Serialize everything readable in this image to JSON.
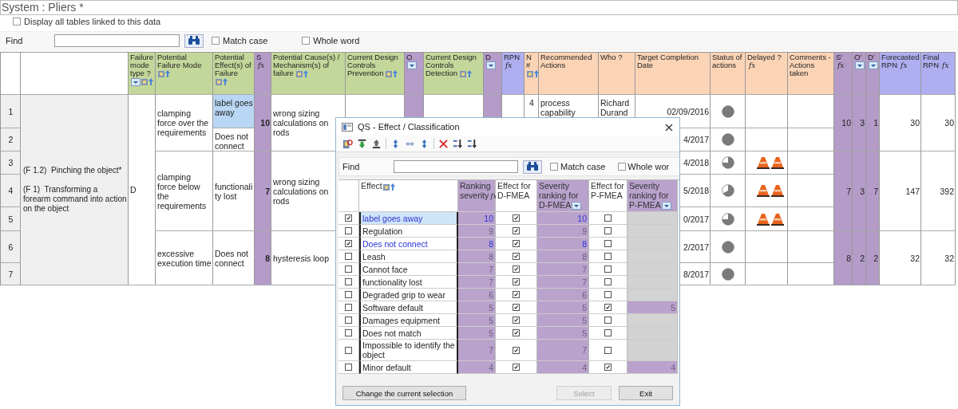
{
  "title": "System : Pliers *",
  "linked_tables": {
    "label": "Display all tables linked to this data",
    "checked": false
  },
  "find": {
    "label": "Find",
    "match_case": {
      "label": "Match case",
      "checked": false
    },
    "whole_word": {
      "label": "Whole word",
      "checked": false
    }
  },
  "table": {
    "columns": [
      {
        "label": "Failure mode type ?",
        "color": "#c4d79b",
        "shaded": false,
        "filter": true,
        "lookup": true
      },
      {
        "label": "Potential Failure Mode",
        "color": "#c4d79b",
        "shaded": false,
        "filter": false,
        "lookup": true
      },
      {
        "label": "Potential Effect(s) of Failure",
        "color": "#c4d79b",
        "shaded": false,
        "filter": false,
        "lookup": true
      },
      {
        "label": "S",
        "color": "#b49bc8",
        "shaded": true,
        "filter": false,
        "lookup": false,
        "fx": "fx"
      },
      {
        "label": "Potential Cause(s) / Mechanism(s) of failure",
        "color": "#c4d79b",
        "shaded": false,
        "filter": false,
        "lookup": true
      },
      {
        "label": "Current Design Controls Prevention",
        "color": "#c4d79b",
        "shaded": false,
        "filter": false,
        "lookup": true
      },
      {
        "label": "O",
        "color": "#b49bc8",
        "shaded": true,
        "filter": true,
        "lookup": false
      },
      {
        "label": "Current Design Controls Detection",
        "color": "#c4d79b",
        "shaded": false,
        "filter": false,
        "lookup": true
      },
      {
        "label": "D",
        "color": "#b49bc8",
        "shaded": true,
        "filter": true,
        "lookup": false
      },
      {
        "label": "RPN",
        "color": "#aeaef0",
        "shaded": false,
        "filter": false,
        "lookup": false,
        "fx": "fx"
      },
      {
        "label": "N#",
        "color": "#fbd4b6",
        "shaded": false,
        "filter": false,
        "lookup": true
      },
      {
        "label": "Recommended Actions",
        "color": "#fbd4b6",
        "shaded": false,
        "filter": false,
        "lookup": false
      },
      {
        "label": "Who ?",
        "color": "#fbd4b6",
        "shaded": false,
        "filter": false,
        "lookup": false
      },
      {
        "label": "Target Completion Date",
        "color": "#fbd4b6",
        "shaded": false,
        "filter": false,
        "lookup": false
      },
      {
        "label": "Status of actions",
        "color": "#fbd4b6",
        "shaded": false,
        "filter": false,
        "lookup": false
      },
      {
        "label": "Delayed ?",
        "color": "#fbd4b6",
        "shaded": false,
        "filter": false,
        "lookup": false,
        "fx": "fx"
      },
      {
        "label": "Comments - Actions taken",
        "color": "#fbd4b6",
        "shaded": false,
        "filter": false,
        "lookup": false
      },
      {
        "label": "S'",
        "color": "#b49bc8",
        "shaded": true,
        "filter": false,
        "lookup": false,
        "fx": "fx"
      },
      {
        "label": "O'",
        "color": "#b49bc8",
        "shaded": true,
        "filter": true,
        "lookup": false
      },
      {
        "label": "D'",
        "color": "#b49bc8",
        "shaded": true,
        "filter": true,
        "lookup": false
      },
      {
        "label": "Forecasted RPN",
        "color": "#aeaef0",
        "shaded": false,
        "filter": false,
        "lookup": false,
        "fx": "fx"
      },
      {
        "label": "Final RPN",
        "color": "#aeaef0",
        "shaded": false,
        "filter": false,
        "lookup": false,
        "fx": "fx"
      }
    ],
    "functions": [
      "(F 1.2)  Pinching the object*",
      "(F 1)  Transforming a forearm command into action on the object"
    ],
    "failure_type": "D",
    "groups": [
      {
        "mode": "clamping force over the requirements",
        "effects": [
          {
            "text": "label goes away",
            "selected": true
          },
          {
            "text": "Does not connect",
            "selected": false
          }
        ],
        "severity": "10",
        "cause": "wrong sizing calculations on rods",
        "s2": "10",
        "o2": "3",
        "d2": "1",
        "forecast": "30",
        "final": "30",
        "rows": [
          {
            "number": "1",
            "n": "4",
            "action": "process capability",
            "who": "Richard Durand",
            "date": "02/09/2016",
            "kind": "full",
            "delayed": false
          },
          {
            "number": "2",
            "date": "4/2017",
            "kind": "full",
            "delayed": false
          }
        ]
      },
      {
        "mode": "clamping force below the requirements",
        "effects": [
          {
            "text": "functionality lost",
            "selected": false
          }
        ],
        "severity": "7",
        "cause": "wrong sizing calculations on rods",
        "s2": "7",
        "o2": "3",
        "d2": "7",
        "forecast": "147",
        "final": "392",
        "rows": [
          {
            "number": "3",
            "date": "4/2018",
            "kind": "three_quarters",
            "delayed": true
          },
          {
            "number": "4",
            "date": "5/2018",
            "kind": "two_thirds",
            "delayed": true
          },
          {
            "number": "5",
            "date": "0/2017",
            "kind": "three_quarters",
            "delayed": true
          }
        ]
      },
      {
        "mode": "excessive execution time",
        "effects": [
          {
            "text": "Does not connect",
            "selected": false
          }
        ],
        "severity": "8",
        "cause": "hysteresis loop",
        "s2": "8",
        "o2": "2",
        "d2": "2",
        "forecast": "32",
        "final": "32",
        "rows": [
          {
            "number": "6",
            "date": "2/2017",
            "kind": "full",
            "delayed": false
          },
          {
            "number": "7",
            "date": "8/2017",
            "kind": "full",
            "delayed": false
          }
        ]
      }
    ]
  },
  "dialog": {
    "title": "QS - Effect / Classification",
    "close": "×",
    "find": {
      "label": "Find",
      "match_case": {
        "label": "Match case",
        "checked": false
      },
      "whole_word": {
        "label": "Whole wor",
        "checked": false
      }
    },
    "columns": [
      {
        "label": "Effect",
        "shaded": false,
        "lookup": true,
        "filter": false
      },
      {
        "label": "Ranking severity",
        "shaded": true,
        "lookup": false,
        "filter": false,
        "fx": "fx"
      },
      {
        "label": "Effect for D-FMEA",
        "shaded": false,
        "lookup": false,
        "filter": false
      },
      {
        "label": "Severity ranking for D-FMEA",
        "shaded": true,
        "lookup": false,
        "filter": true
      },
      {
        "label": "Effect for P-FMEA",
        "shaded": false,
        "lookup": false,
        "filter": false
      },
      {
        "label": "Severity ranking for P-FMEA",
        "shaded": true,
        "lookup": false,
        "filter": true
      }
    ],
    "effects": [
      {
        "name": "label goes away",
        "selected": true,
        "current": true,
        "ranking": "10",
        "d_fmea": true,
        "d_rank": "10",
        "p_fmea": false
      },
      {
        "name": "Regulation",
        "selected": false,
        "current": false,
        "ranking": "9",
        "d_fmea": true,
        "d_rank": "9",
        "p_fmea": false
      },
      {
        "name": "Does not connect",
        "selected": true,
        "current": false,
        "ranking": "8",
        "d_fmea": true,
        "d_rank": "8",
        "p_fmea": false
      },
      {
        "name": "Leash",
        "selected": false,
        "current": false,
        "ranking": "8",
        "d_fmea": true,
        "d_rank": "8",
        "p_fmea": false
      },
      {
        "name": "Cannot face",
        "selected": false,
        "current": false,
        "ranking": "7",
        "d_fmea": true,
        "d_rank": "7",
        "p_fmea": false
      },
      {
        "name": "functionality lost",
        "selected": false,
        "current": false,
        "ranking": "7",
        "d_fmea": true,
        "d_rank": "7",
        "p_fmea": false
      },
      {
        "name": "Degraded grip to wear",
        "selected": false,
        "current": false,
        "ranking": "6",
        "d_fmea": true,
        "d_rank": "6",
        "p_fmea": false
      },
      {
        "name": "Software default",
        "selected": false,
        "current": false,
        "ranking": "5",
        "d_fmea": true,
        "d_rank": "5",
        "p_fmea": true,
        "p_rank": "5"
      },
      {
        "name": "Damages equipment",
        "selected": false,
        "current": false,
        "ranking": "5",
        "d_fmea": true,
        "d_rank": "5",
        "p_fmea": false
      },
      {
        "name": "Does not match",
        "selected": false,
        "current": false,
        "ranking": "5",
        "d_fmea": true,
        "d_rank": "5",
        "p_fmea": false
      },
      {
        "name": "Impossible to identify the object",
        "selected": false,
        "current": false,
        "ranking": "7",
        "d_fmea": true,
        "d_rank": "7",
        "p_fmea": false
      },
      {
        "name": "Minor default",
        "selected": false,
        "current": false,
        "ranking": "4",
        "d_fmea": true,
        "d_rank": "4",
        "p_fmea": true,
        "p_rank": "4"
      }
    ],
    "buttons": [
      {
        "label": "Change the current selection",
        "disabled": false
      },
      {
        "label": "Select",
        "disabled": true
      },
      {
        "label": "Exit",
        "disabled": false
      }
    ]
  }
}
